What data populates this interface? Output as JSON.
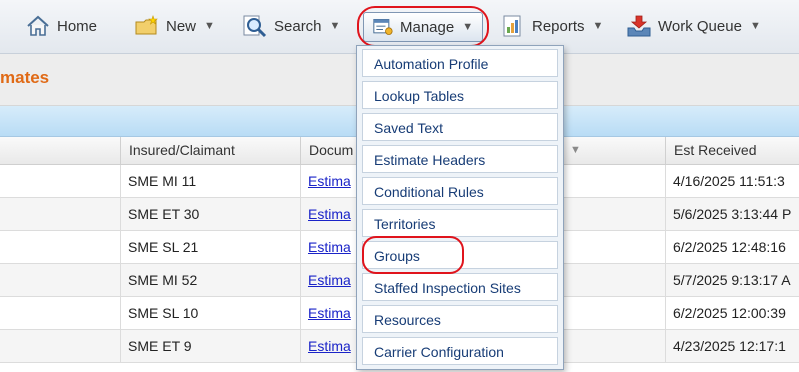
{
  "toolbar": {
    "home_label": "Home",
    "new_label": "New",
    "search_label": "Search",
    "manage_label": "Manage",
    "reports_label": "Reports",
    "work_queue_label": "Work Queue",
    "caret": "▼"
  },
  "page": {
    "title": "mates"
  },
  "table": {
    "columns": [
      "Insured/Claimant",
      "Docum",
      "Est Received"
    ],
    "sort_glyph": "▼",
    "rows": [
      {
        "insured": "SME MI 11",
        "doc": "Estima",
        "received": "4/16/2025 11:51:3"
      },
      {
        "insured": "SME ET 30",
        "doc": "Estima",
        "received": "5/6/2025 3:13:44 P"
      },
      {
        "insured": "SME SL 21",
        "doc": "Estima",
        "received": "6/2/2025 12:48:16"
      },
      {
        "insured": "SME MI 52",
        "doc": "Estima",
        "received": "5/7/2025 9:13:17 A"
      },
      {
        "insured": "SME SL 10",
        "doc": "Estima",
        "received": "6/2/2025 12:00:39"
      },
      {
        "insured": "SME ET 9",
        "doc": "Estima",
        "received": "4/23/2025 12:17:1"
      }
    ]
  },
  "manage_menu": {
    "items": [
      "Automation Profile",
      "Lookup Tables",
      "Saved Text",
      "Estimate Headers",
      "Conditional Rules",
      "Territories",
      "Groups",
      "Staffed Inspection Sites",
      "Resources",
      "Carrier Configuration"
    ]
  },
  "colors": {
    "title_orange": "#e06a16",
    "highlight_red": "#e0141c",
    "menu_text": "#173c76",
    "link_blue": "#1a23c8"
  }
}
